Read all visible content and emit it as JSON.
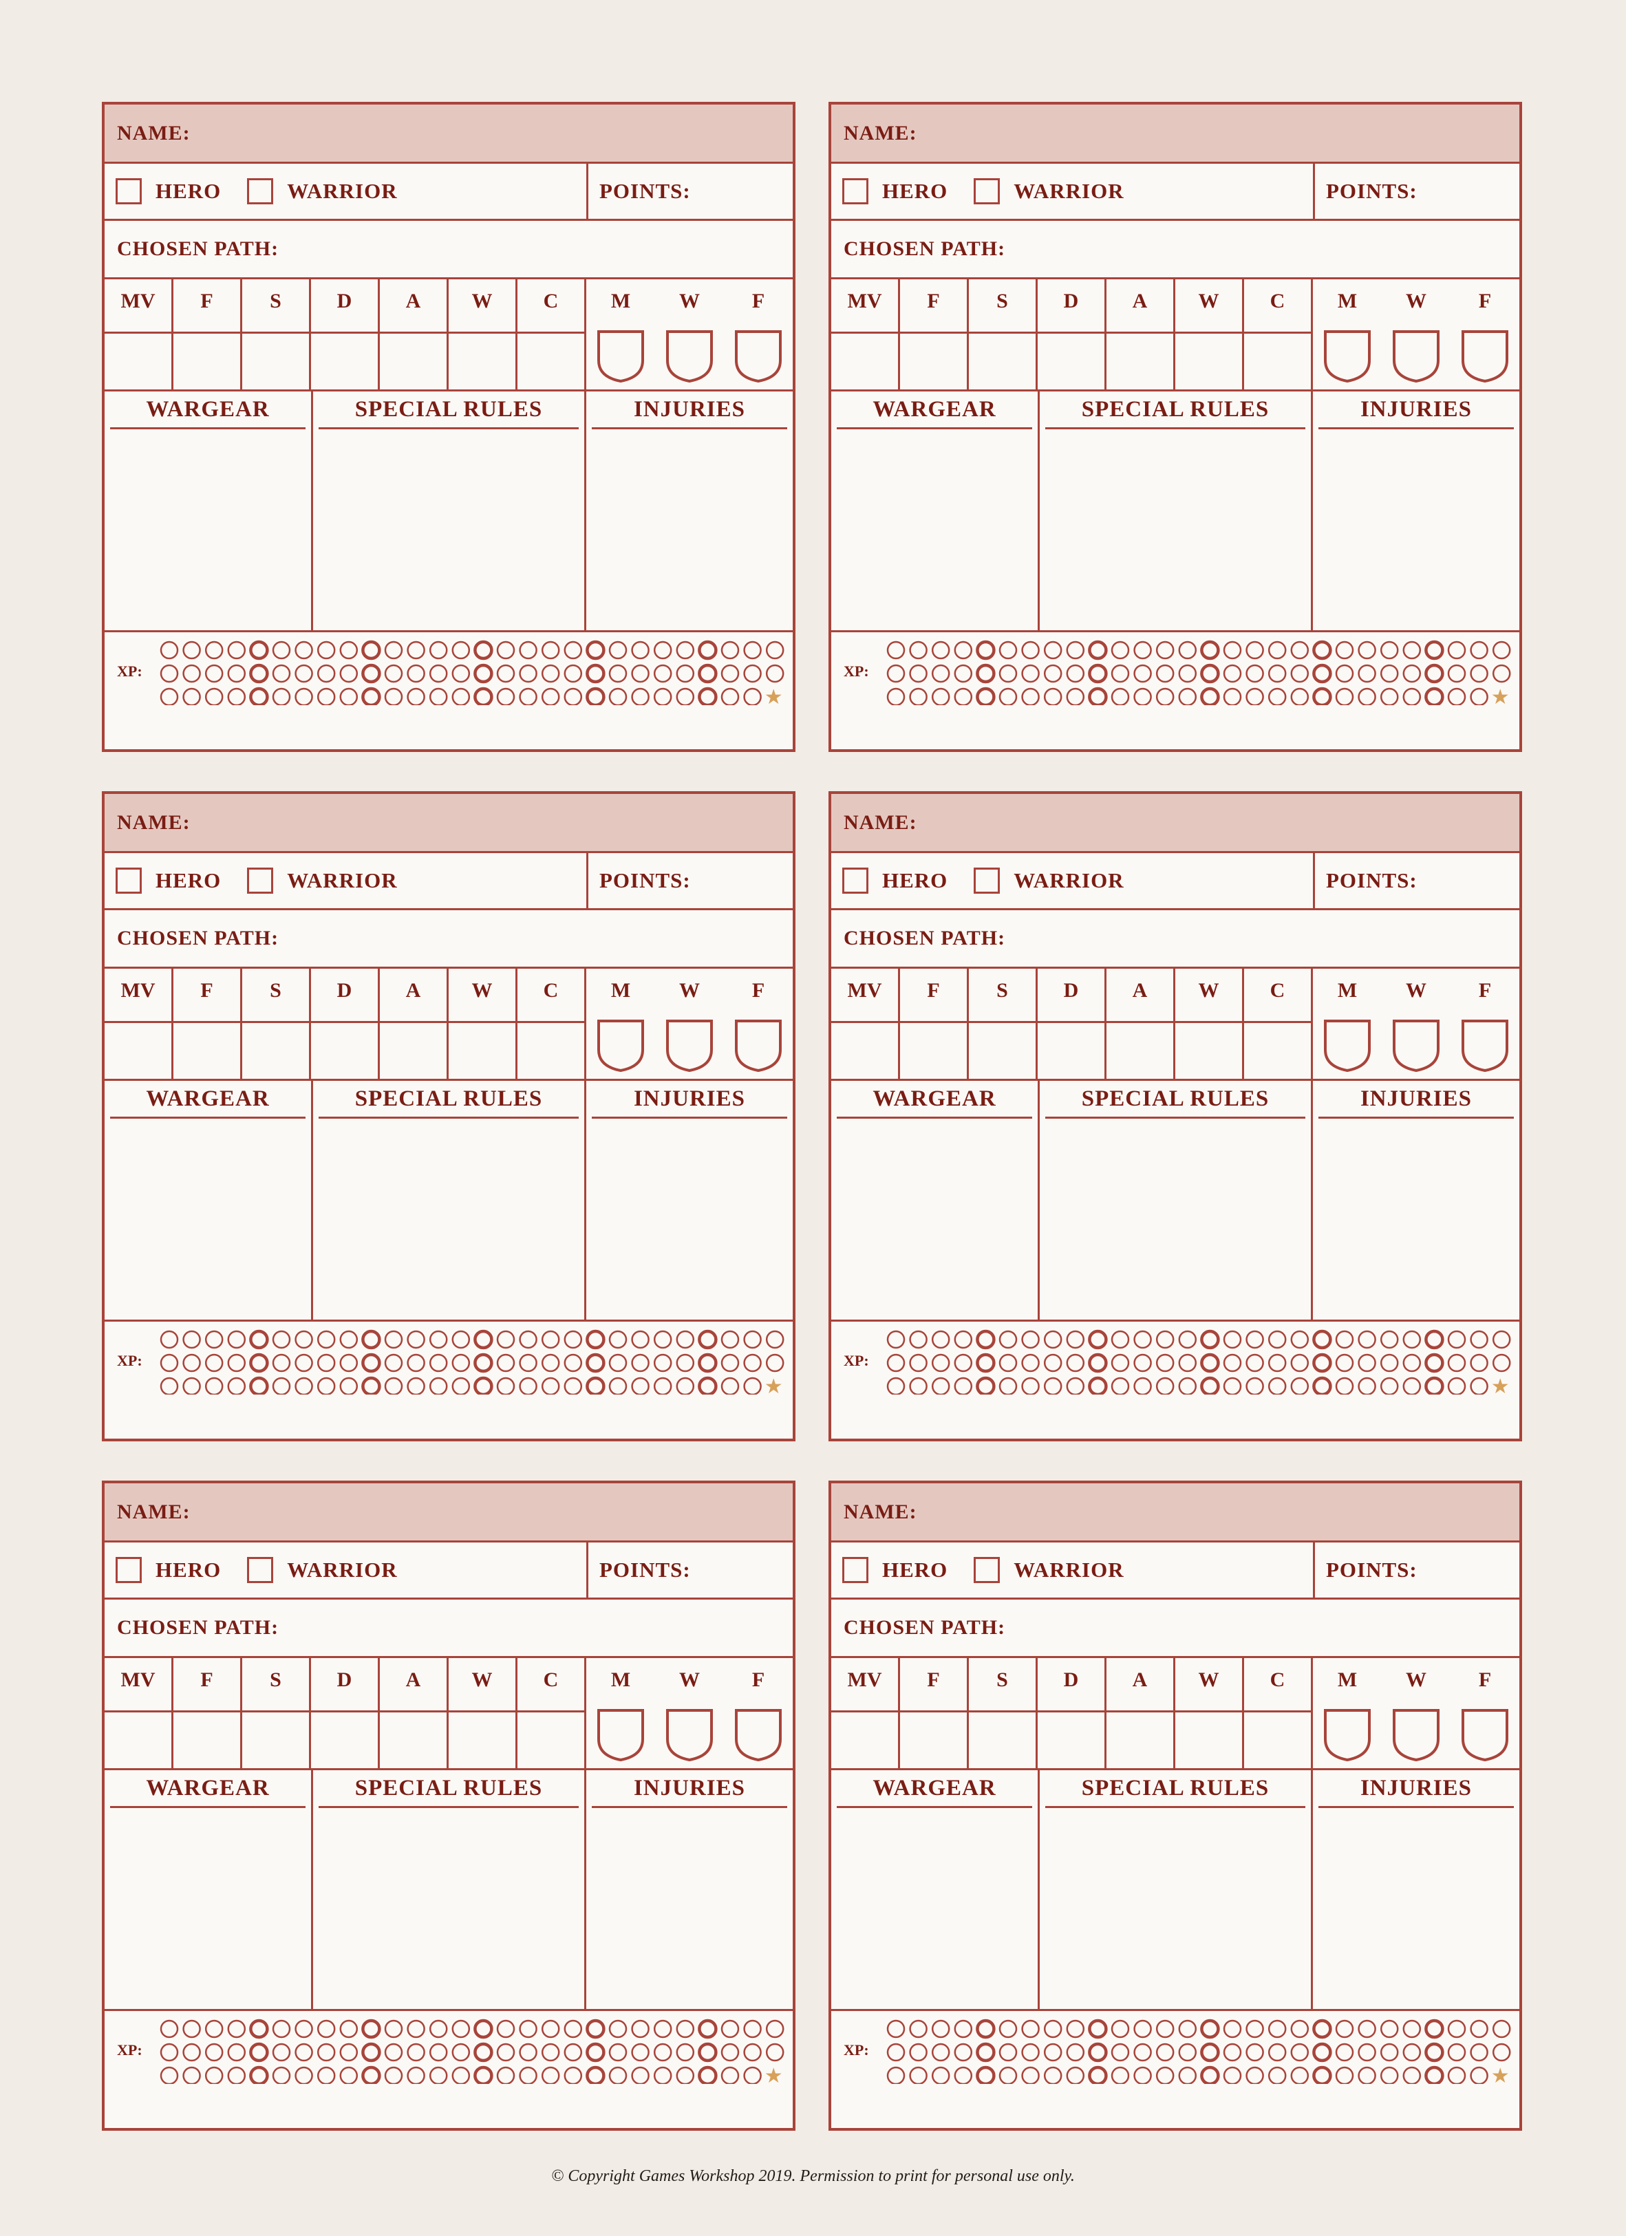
{
  "card": {
    "name_label": "NAME:",
    "hero_label": "HERO",
    "warrior_label": "WARRIOR",
    "points_label": "POINTS:",
    "path_label": "CHOSEN PATH:",
    "stat_labels": [
      "MV",
      "F",
      "S",
      "D",
      "A",
      "W",
      "C"
    ],
    "mwf_labels": [
      "M",
      "W",
      "F"
    ],
    "sections": [
      "WARGEAR",
      "SPECIAL RULES",
      "INJURIES"
    ],
    "xp_label": "XP:",
    "xp_rows": 3,
    "xp_per_row": 28,
    "xp_last_symbol": "★"
  },
  "card_count": 6,
  "colors": {
    "border": "#a8443a",
    "header_fill": "#e4c8c0",
    "text": "#7a1d14",
    "star": "#d7a15a",
    "page": "#f1ece6"
  },
  "footer": "© Copyright Games Workshop 2019. Permission to print for personal use only."
}
